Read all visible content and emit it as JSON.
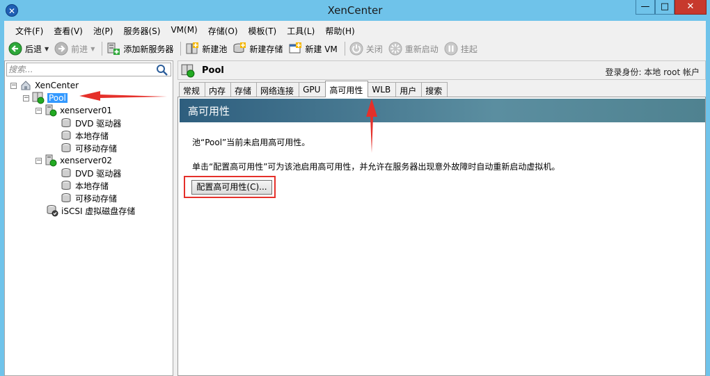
{
  "window": {
    "title": "XenCenter",
    "min_glyph": "—",
    "max_glyph": "□",
    "close_glyph": "✕"
  },
  "menu": [
    "文件(F)",
    "查看(V)",
    "池(P)",
    "服务器(S)",
    "VM(M)",
    "存储(O)",
    "模板(T)",
    "工具(L)",
    "帮助(H)"
  ],
  "toolbar": {
    "back_label": "后退",
    "forward_label": "前进",
    "add_server_label": "添加新服务器",
    "new_pool_label": "新建池",
    "new_storage_label": "新建存储",
    "new_vm_label": "新建 VM",
    "shutdown_label": "关闭",
    "reboot_label": "重新启动",
    "suspend_label": "挂起"
  },
  "search": {
    "placeholder": "搜索..."
  },
  "tree": {
    "root": "XenCenter",
    "pool": "Pool",
    "server1": "xenserver01",
    "server1_dvd": "DVD 驱动器",
    "server1_local": "本地存储",
    "server1_removable": "可移动存储",
    "server2": "xenserver02",
    "server2_dvd": "DVD 驱动器",
    "server2_local": "本地存储",
    "server2_removable": "可移动存储",
    "iscsi": "iSCSI 虚拟磁盘存储"
  },
  "header": {
    "title": "Pool",
    "login": "登录身份: 本地 root 帐户"
  },
  "tabs": [
    "常规",
    "内存",
    "存储",
    "网络连接",
    "GPU",
    "高可用性",
    "WLB",
    "用户",
    "搜索"
  ],
  "active_tab_index": 5,
  "content": {
    "banner": "高可用性",
    "status": "池“Pool”当前未启用高可用性。",
    "description": "单击“配置高可用性”可为该池启用高可用性，并允许在服务器出现意外故障时自动重新启动虚拟机。",
    "config_button": "配置高可用性(C)..."
  },
  "colors": {
    "titlebar": "#6fc3ea",
    "selection": "#3399ff",
    "annotation_red": "#e5302a",
    "status_green": "#22aa22"
  }
}
